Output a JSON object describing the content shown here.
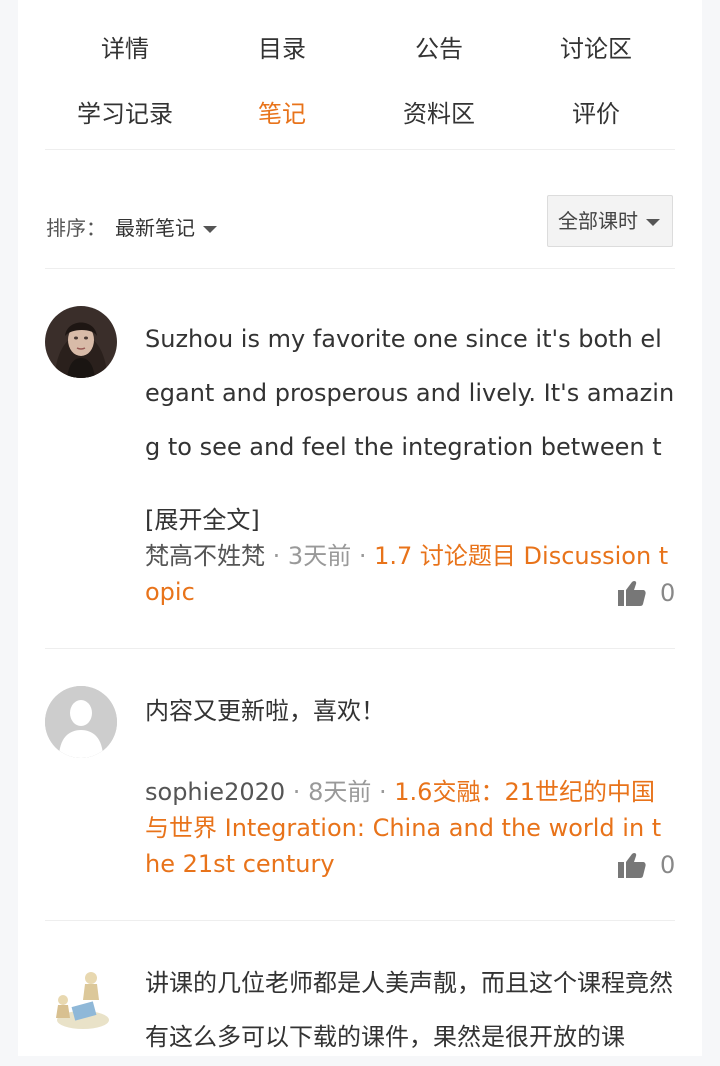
{
  "tabs": {
    "row1": [
      "详情",
      "目录",
      "公告",
      "讨论区"
    ],
    "row2": [
      "学习记录",
      "笔记",
      "资料区",
      "评价"
    ],
    "active": "笔记"
  },
  "sort": {
    "label": "排序：",
    "value": "最新笔记",
    "lesson_filter": "全部课时"
  },
  "notes": [
    {
      "content": "Suzhou is my favorite one since it's both elegant and prosperous and lively. It's amazing to see and feel the integration between the moderazat",
      "expand": "[展开全文]",
      "author": "梵高不姓梵",
      "time": "3天前",
      "lesson": "1.7 讨论题目 Discussion topic",
      "likes": "0"
    },
    {
      "content": "内容又更新啦，喜欢！",
      "author": "sophie2020",
      "time": "8天前",
      "lesson": "1.6交融：21世纪的中国与世界 Integration: China and the world in the 21st century",
      "likes": "0"
    },
    {
      "content": "讲课的几位老师都是人美声靓，而且这个课程竟然有这么多可以下载的课件，果然是很开放的课"
    }
  ],
  "separator": "·"
}
